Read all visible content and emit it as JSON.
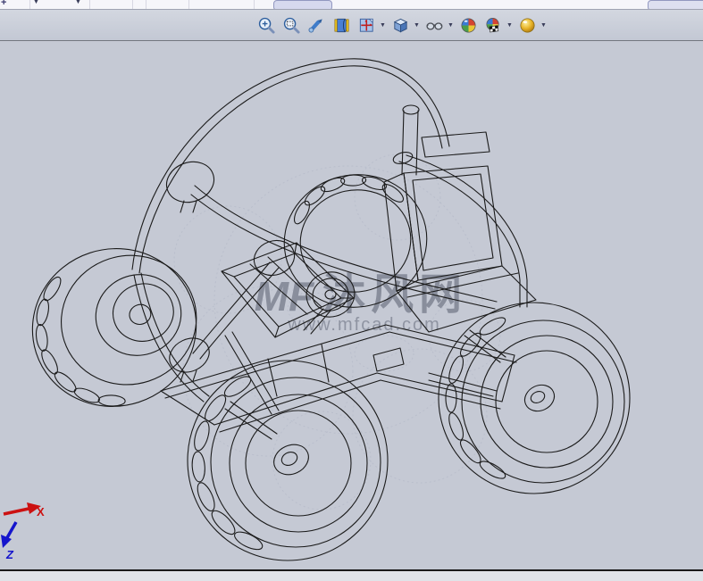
{
  "ui": {
    "plus_glyph": "+",
    "dropdown_glyph": "▼"
  },
  "toolbar": {
    "buttons": [
      {
        "id": "zoom-to-fit",
        "dropdown": false
      },
      {
        "id": "zoom-to-area",
        "dropdown": false
      },
      {
        "id": "rotate-view",
        "dropdown": false
      },
      {
        "id": "previous-view",
        "dropdown": false
      },
      {
        "id": "section-view",
        "dropdown": true
      },
      {
        "id": "view-orientation",
        "dropdown": true
      },
      {
        "id": "display-style",
        "dropdown": true
      },
      {
        "id": "edit-appearance",
        "dropdown": false
      },
      {
        "id": "apply-scene",
        "dropdown": true
      },
      {
        "id": "view-settings",
        "dropdown": true
      }
    ]
  },
  "viewport": {
    "watermark": {
      "logo": "MF",
      "site_name": "沐风网",
      "site_url": "www.mfcad.com"
    },
    "axis_triad": {
      "x_label": "X",
      "z_label": "Z"
    }
  },
  "colors": {
    "viewport_bg": "#c5c9d4",
    "toolbar_bg": "#c9cdd8",
    "top_strip_bg": "#f6f6fa",
    "status_bar_bg": "#e0e3e8",
    "model_line": "#1b1b1b",
    "watermark_gray": "#878c9b",
    "axis_x_red": "#cc1111",
    "axis_z_blue": "#1515cc"
  }
}
